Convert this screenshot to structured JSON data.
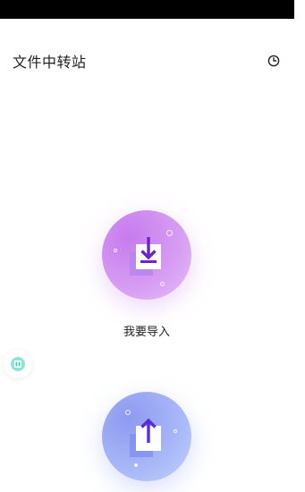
{
  "status_bar": {},
  "header": {
    "title": "文件中转站",
    "history_icon": "clock-icon"
  },
  "actions": {
    "import": {
      "label": "我要导入",
      "icon": "download-arrow-icon",
      "color": "#c77bee"
    },
    "export": {
      "label": "",
      "icon": "upload-arrow-icon",
      "color": "#8e9af1"
    }
  },
  "floating_button": {
    "icon": "app-icon",
    "color": "#64d6c8"
  }
}
